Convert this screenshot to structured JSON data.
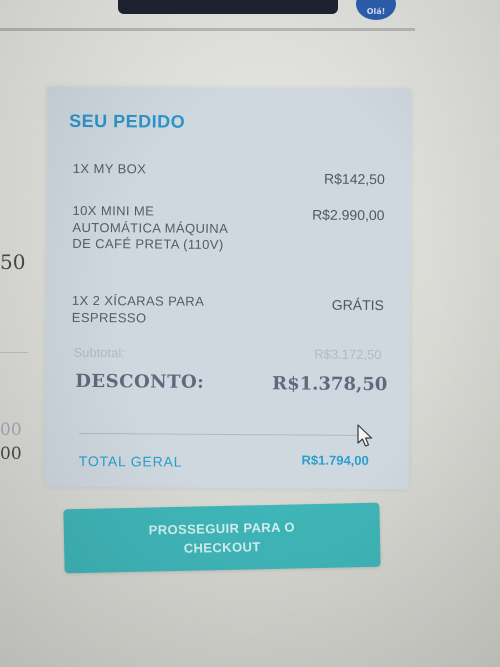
{
  "header": {
    "avatar_text": "Olá!"
  },
  "left_fragments": {
    "frag_1": "50",
    "frag_2": "00",
    "frag_3": "00"
  },
  "order": {
    "title": "SEU PEDIDO",
    "items": [
      {
        "name": "1X MY BOX",
        "price": "R$142,50"
      },
      {
        "name": "10X MINI ME AUTOMÁTICA MÁQUINA DE CAFÉ PRETA (110V)",
        "price": "R$2.990,00"
      },
      {
        "name": "1X 2 XÍCARAS PARA ESPRESSO",
        "price": "GRÁTIS"
      }
    ],
    "subtotal_label": "Subtotal:",
    "subtotal_value": "R$3.172,50",
    "discount_label": "DESCONTO:",
    "discount_value": "R$1.378,50",
    "total_label": "TOTAL GERAL",
    "total_value": "R$1.794,00"
  },
  "checkout_button": {
    "label": "PROSSEGUIR PARA O CHECKOUT",
    "color": "#3fb5b8"
  },
  "icons": {
    "cursor": "mouse-pointer-icon"
  }
}
